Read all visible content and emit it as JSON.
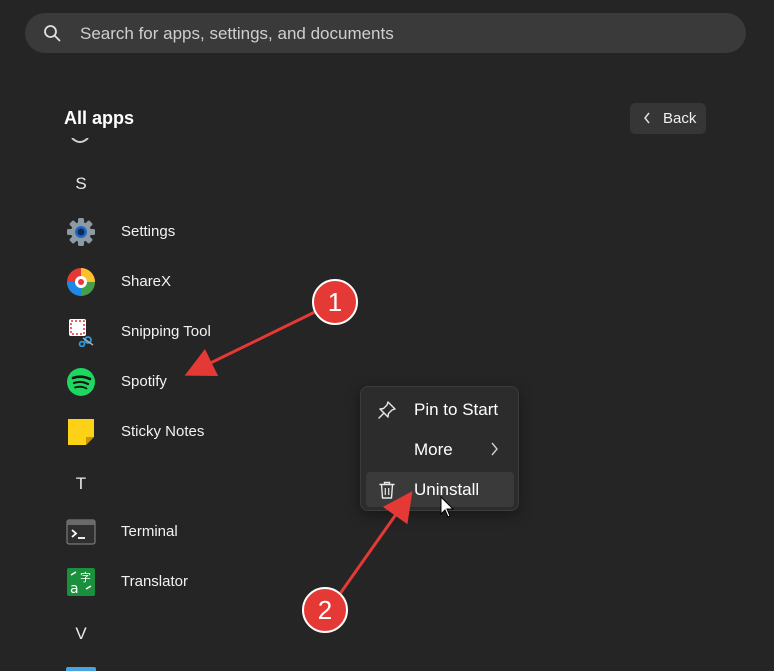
{
  "search": {
    "placeholder": "Search for apps, settings, and documents"
  },
  "header": {
    "title": "All apps",
    "back_label": "Back"
  },
  "sections": [
    {
      "letter": "S",
      "apps": [
        "Settings",
        "ShareX",
        "Snipping Tool",
        "Spotify",
        "Sticky Notes"
      ]
    },
    {
      "letter": "T",
      "apps": [
        "Terminal",
        "Translator"
      ]
    },
    {
      "letter": "V",
      "apps": []
    }
  ],
  "context_menu": {
    "items": [
      {
        "label": "Pin to Start",
        "icon": "pin-icon"
      },
      {
        "label": "More",
        "icon": "",
        "has_submenu": true
      },
      {
        "label": "Uninstall",
        "icon": "trash-icon",
        "highlighted": true
      }
    ]
  },
  "annotations": [
    {
      "number": "1",
      "color": "#e53935"
    },
    {
      "number": "2",
      "color": "#e53935"
    }
  ],
  "colors": {
    "background": "#252525",
    "search_bg": "#3a3a3a",
    "menu_bg": "#2c2c2c",
    "annotation": "#e53935"
  }
}
